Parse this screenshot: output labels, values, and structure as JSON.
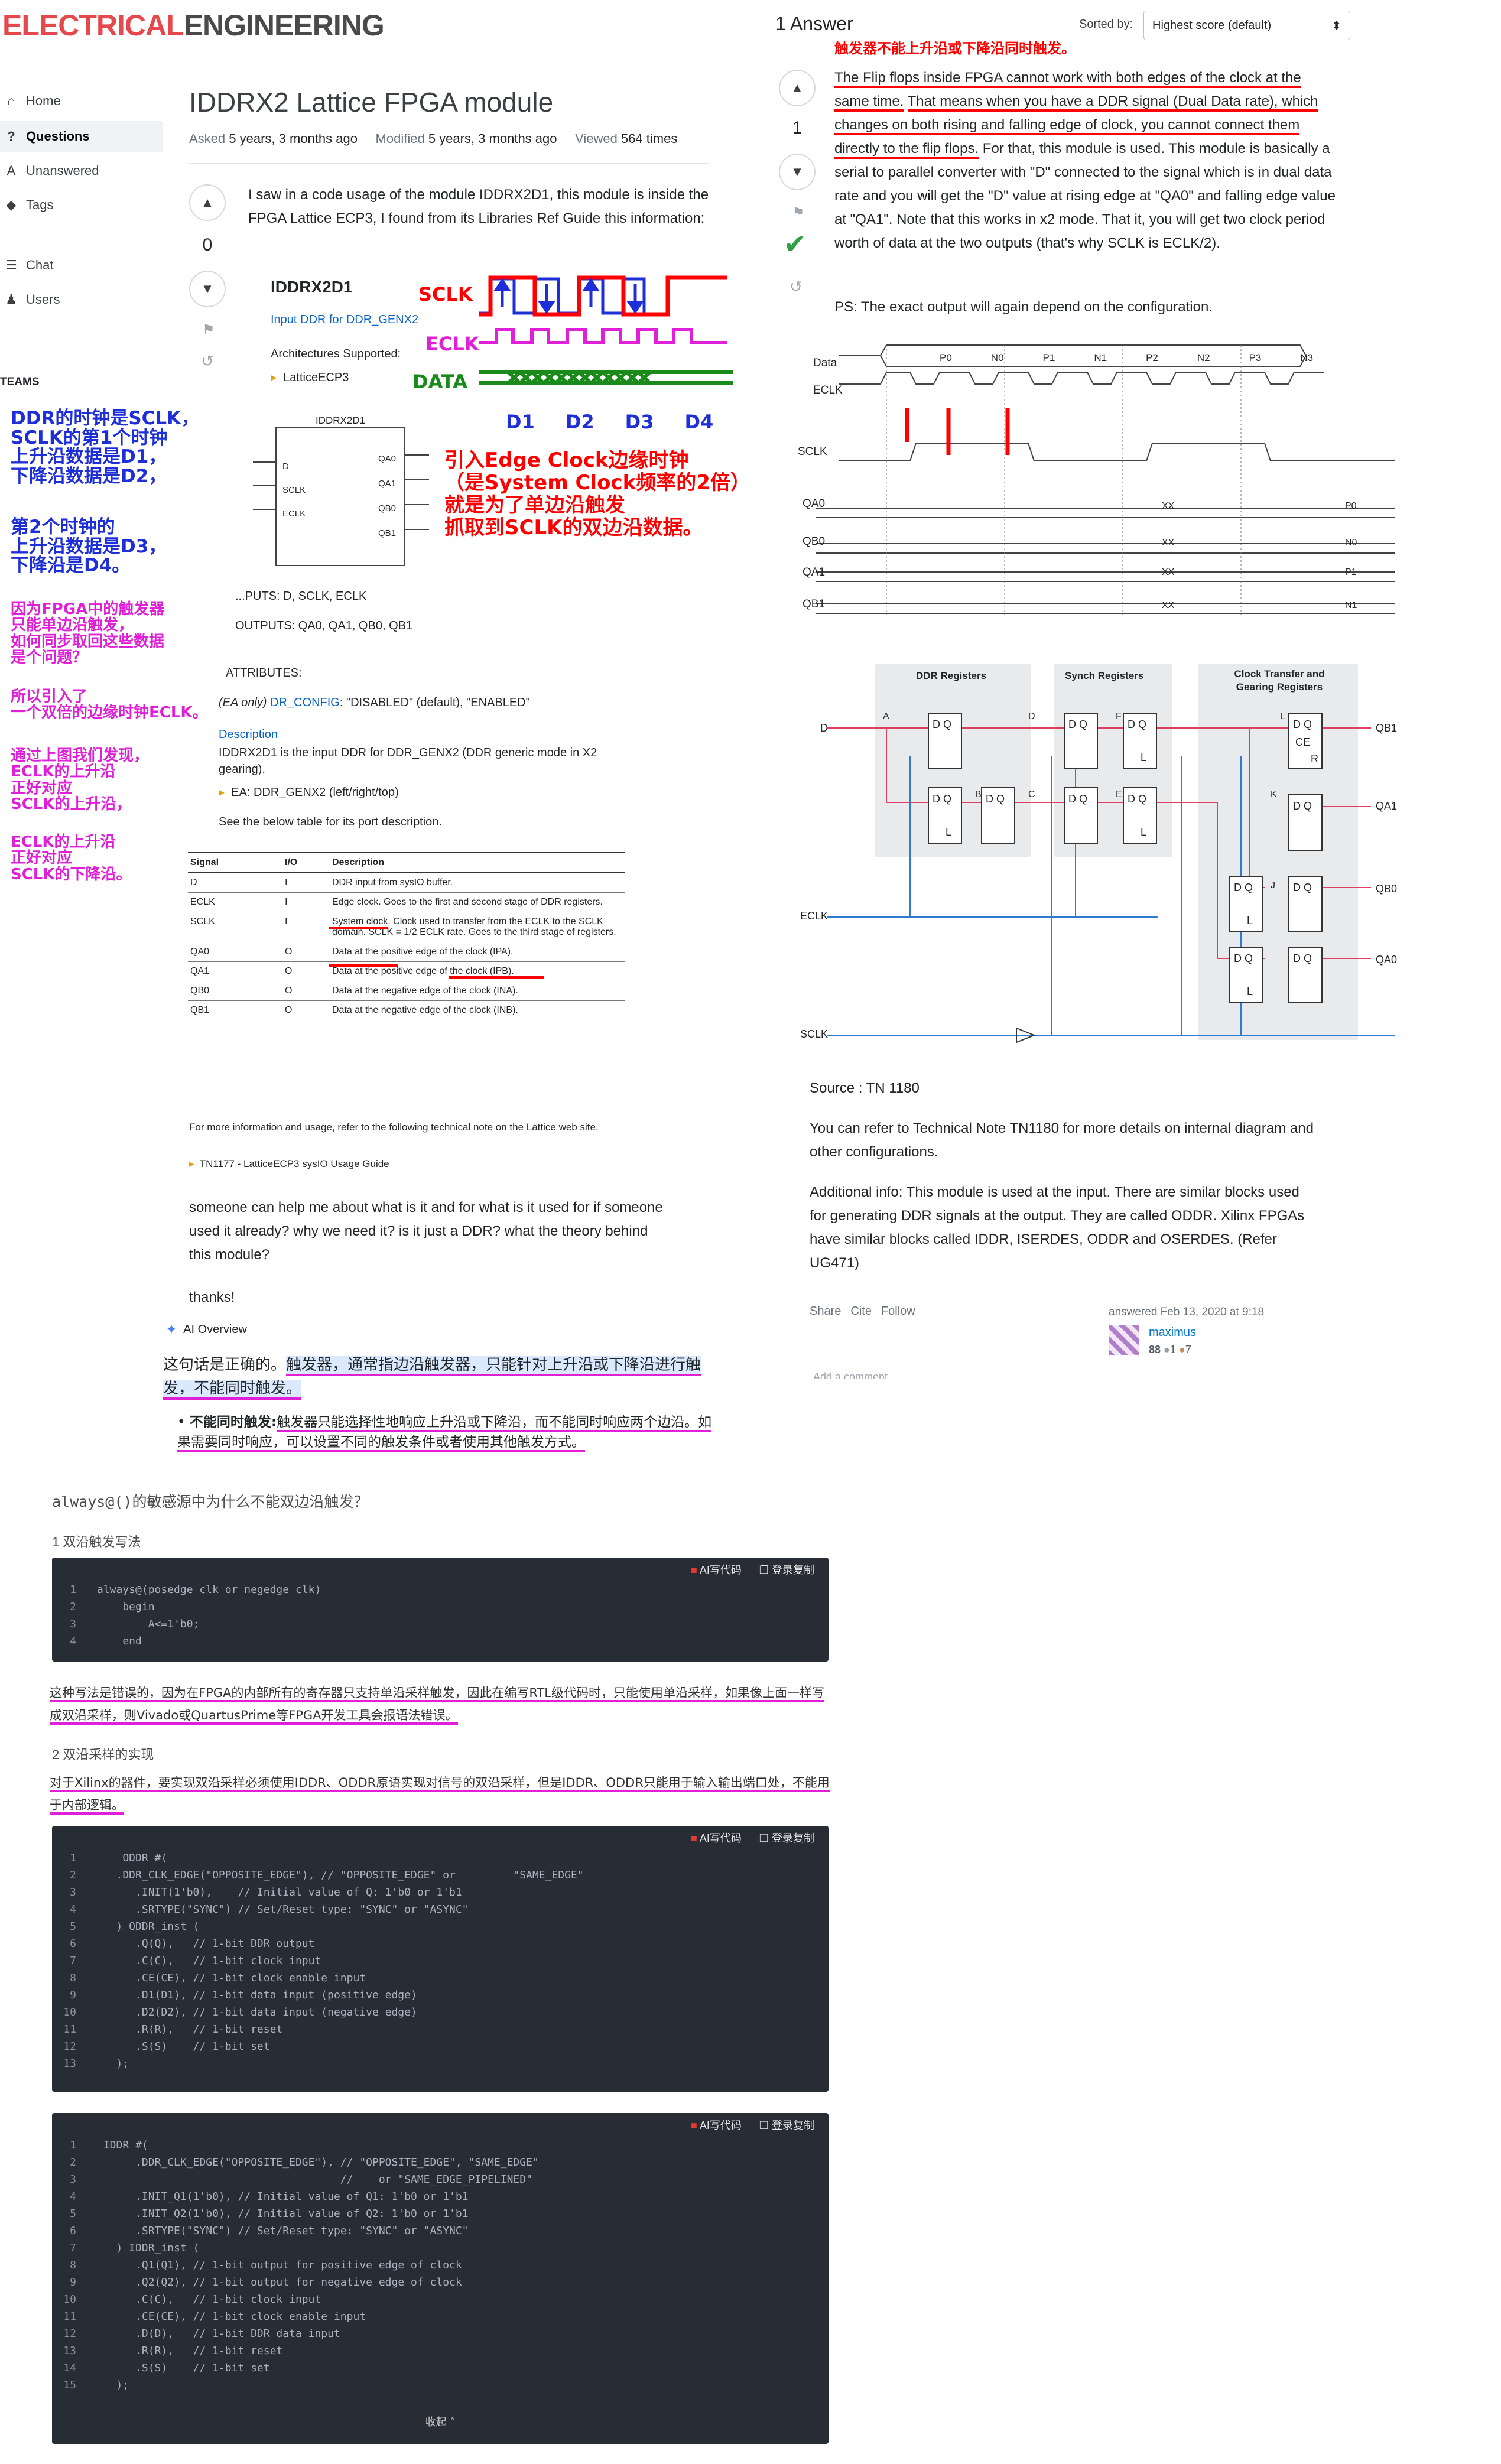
{
  "site": {
    "logo_part1": "ELECTRICAL",
    "logo_part2": "ENGINEERING"
  },
  "sidebar": {
    "items": [
      {
        "label": "Home",
        "icon": "home-icon"
      },
      {
        "label": "Questions",
        "icon": "questions-icon"
      },
      {
        "label": "Unanswered",
        "icon": "unanswered-icon"
      },
      {
        "label": "Tags",
        "icon": "tag-icon"
      },
      {
        "label": "Chat",
        "icon": "chat-icon"
      },
      {
        "label": "Users",
        "icon": "users-icon"
      }
    ],
    "teams": "TEAMS"
  },
  "annotations_left": {
    "a1": "DDR的时钟是SCLK，\nSCLK的第1个时钟\n上升沿数据是D1，\n下降沿数据是D2，",
    "a2": "第2个时钟的\n上升沿数据是D3，\n下降沿是D4。",
    "a3": "因为FPGA中的触发器\n只能单边沿触发，\n如何同步取回这些数据\n是个问题？",
    "a4": "所以引入了\n一个双倍的边缘时钟ECLK。",
    "a5": "通过上图我们发现，\nECLK的上升沿\n正好对应\nSCLK的上升沿，",
    "a6": "ECLK的上升沿\n正好对应\nSCLK的下降沿。"
  },
  "question": {
    "title": "IDDRX2 Lattice FPGA module",
    "asked_label": "Asked",
    "asked_value": "5 years, 3 months ago",
    "modified_label": "Modified",
    "modified_value": "5 years, 3 months ago",
    "viewed_label": "Viewed",
    "viewed_value": "564 times",
    "votes": "0",
    "intro": "I saw in a code usage of the module IDDRX2D1, this module is inside the FPGA Lattice ECP3, I found from its Libraries Ref Guide this information:",
    "doc": {
      "heading": "IDDRX2D1",
      "subtitle": "Input DDR for DDR_GENX2",
      "arch_label": "Architectures Supported:",
      "arch_value": "LatticeECP3",
      "block_name": "IDDRX2D1",
      "pins_left": [
        "D",
        "SCLK",
        "ECLK"
      ],
      "pins_right": [
        "QA0",
        "QA1",
        "QB0",
        "QB1"
      ],
      "inputs": "...PUTS: D, SCLK, ECLK",
      "outputs": "OUTPUTS: QA0, QA1, QB0, QB1",
      "attributes": "ATTRIBUTES:",
      "dr_config_prefix": "(EA only)",
      "dr_config_link": "DR_CONFIG",
      "dr_config_rest": ": \"DISABLED\" (default), \"ENABLED\"",
      "desc_heading": "Description",
      "desc_text": "IDDRX2D1 is the input DDR for DDR_GENX2 (DDR generic mode in X2 gearing).",
      "ea_line": "EA: DDR_GENX2 (left/right/top)",
      "table_intro": "See the below table for its port description.",
      "table_headers": [
        "Signal",
        "I/O",
        "Description"
      ],
      "table_rows": [
        [
          "D",
          "I",
          "DDR input from sysIO buffer."
        ],
        [
          "ECLK",
          "I",
          "Edge clock. Goes to the first and second stage of DDR registers."
        ],
        [
          "SCLK",
          "I",
          "System clock. Clock used to transfer from the ECLK to the SCLK domain. SCLK = 1/2 ECLK rate. Goes to the third stage of registers."
        ],
        [
          "QA0",
          "O",
          "Data at the positive edge of the clock (IPA)."
        ],
        [
          "QA1",
          "O",
          "Data at the positive edge of the clock (IPB)."
        ],
        [
          "QB0",
          "O",
          "Data at the negative edge of the clock (INA)."
        ],
        [
          "QB1",
          "O",
          "Data at the negative edge of the clock (INB)."
        ]
      ],
      "more_info": "For more information and usage, refer to the following technical note on the Lattice web site.",
      "tn_link": "TN1177 - LatticeECP3 sysIO Usage Guide"
    },
    "waveform": {
      "sclk": "SCLK",
      "eclk": "ECLK",
      "data": "DATA",
      "d_labels": [
        "D1",
        "D2",
        "D3",
        "D4"
      ]
    },
    "callout": "引入Edge Clock边缘时钟\n（是System Clock频率的2倍）\n就是为了单边沿触发\n抓取到SCLK的双边沿数据。",
    "ask": "someone can help me about what is it and for what is it used for if someone used it already? why we need it? is it just a DDR? what the theory behind this module?",
    "thanks": "thanks!"
  },
  "ai_overview": {
    "label": "AI Overview",
    "p1_plain": "这句话是正确的。",
    "p1_hl": "触发器，通常指边沿触发器，只能针对上升沿或下降沿进行触发，不能同时触发。",
    "bullet_bold": "不能同时触发:",
    "bullet_text": "触发器只能选择性地响应上升沿或下降沿，而不能同时响应两个边沿。如果需要同时响应，可以设置不同的触发条件或者使用其他触发方式。"
  },
  "answer": {
    "count": "1 Answer",
    "sorted_label": "Sorted by:",
    "sorted_value": "Highest score (default)",
    "top_note": "触发器不能上升沿或下降沿同时触发。",
    "votes": "1",
    "p1_red1": "The Flip flops inside FPGA cannot work with both edges of the clock at the same time.",
    "p1_mid": " ",
    "p1_red2": "That means when you have a DDR signal (Dual Data rate), which changes on both rising and falling edge of clock, you cannot connect them directly to the flip flops.",
    "p1_rest": " For that, this module is used. This module is basically a serial to parallel converter with \"D\" connected to the signal which is in dual data rate and you will get the \"D\" value at rising edge at \"QA0\" and falling edge value at \"QA1\". Note that this works in x2 mode. That it, you will get two clock period worth of data at the two outputs (that's why SCLK is ECLK/2).",
    "ps": "PS: The exact output will again depend on the configuration.",
    "timing": {
      "rows": [
        "Data",
        "ECLK",
        "SCLK",
        "QA0",
        "QB0",
        "QA1",
        "QB1"
      ],
      "data_labels": [
        "P0",
        "N0",
        "P1",
        "N1",
        "P2",
        "N2",
        "P3",
        "N3"
      ],
      "xx": "XX",
      "outs": [
        "P0",
        "N0",
        "P1",
        "N1"
      ]
    },
    "diagram": {
      "blocks": [
        "DDR Registers",
        "Synch Registers",
        "Clock Transfer and Gearing Registers"
      ],
      "inputs": [
        "D",
        "ECLK",
        "SCLK"
      ],
      "outputs": [
        "QB1",
        "QA1",
        "QB0",
        "QA0"
      ],
      "nodes": [
        "A",
        "B",
        "C",
        "D",
        "E",
        "F",
        "J",
        "K",
        "L"
      ],
      "dq": "D Q",
      "ce": "CE",
      "r": "R",
      "l": "L"
    },
    "source": "Source : TN 1180",
    "p2": "You can refer to Technical Note TN1180 for more details on internal diagram and other configurations.",
    "p3": "Additional info: This module is used at the input. There are similar blocks used for generating DDR signals at the output. They are called ODDR. Xilinx FPGAs have similar blocks called IDDR, ISERDES, ODDR and OSERDES. (Refer UG471)",
    "actions": [
      "Share",
      "Cite",
      "Follow"
    ],
    "answered": "answered Feb 13, 2020 at 9:18",
    "user": "maximus",
    "rep": "88",
    "badge_silver": "1",
    "badge_bronze": "7",
    "add_comment": "Add a comment"
  },
  "blog": {
    "question": "always@()的敏感源中为什么不能双边沿触发？",
    "h1": "1  双沿触发写法",
    "ai_code": "AI写代码",
    "login_copy": "登录复制",
    "code1": [
      "always@(posedge clk or negedge clk)",
      "    begin",
      "        A<=1'b0;",
      "    end"
    ],
    "p1": "这种写法是错误的，因为在FPGA的内部所有的寄存器只支持单沿采样触发，因此在编写RTL级代码时，只能使用单沿采样，如果像上面一样写成双沿采样，则Vivado或QuartusPrime等FPGA开发工具会报语法错误。",
    "h2": "2  双沿采样的实现",
    "p2": "对于Xilinx的器件，要实现双沿采样必须使用IDDR、ODDR原语实现对信号的双沿采样，但是IDDR、ODDR只能用于输入输出端口处，不能用于内部逻辑。",
    "code2": [
      "    ODDR #(",
      "   .DDR_CLK_EDGE(\"OPPOSITE_EDGE\"), // \"OPPOSITE_EDGE\" or         \"SAME_EDGE\"",
      "      .INIT(1'b0),    // Initial value of Q: 1'b0 or 1'b1",
      "      .SRTYPE(\"SYNC\") // Set/Reset type: \"SYNC\" or \"ASYNC\"",
      "   ) ODDR_inst (",
      "      .Q(Q),   // 1-bit DDR output",
      "      .C(C),   // 1-bit clock input",
      "      .CE(CE), // 1-bit clock enable input",
      "      .D1(D1), // 1-bit data input (positive edge)",
      "      .D2(D2), // 1-bit data input (negative edge)",
      "      .R(R),   // 1-bit reset",
      "      .S(S)    // 1-bit set",
      "   );"
    ],
    "code3": [
      " IDDR #(",
      "      .DDR_CLK_EDGE(\"OPPOSITE_EDGE\"), // \"OPPOSITE_EDGE\", \"SAME_EDGE\"",
      "                                      //    or \"SAME_EDGE_PIPELINED\"",
      "      .INIT_Q1(1'b0), // Initial value of Q1: 1'b0 or 1'b1",
      "      .INIT_Q2(1'b0), // Initial value of Q2: 1'b0 or 1'b1",
      "      .SRTYPE(\"SYNC\") // Set/Reset type: \"SYNC\" or \"ASYNC\"",
      "   ) IDDR_inst (",
      "      .Q1(Q1), // 1-bit output for positive edge of clock",
      "      .Q2(Q2), // 1-bit output for negative edge of clock",
      "      .C(C),   // 1-bit clock input",
      "      .CE(CE), // 1-bit clock enable input",
      "      .D(D),   // 1-bit DDR data input",
      "      .R(R),   // 1-bit reset",
      "      .S(S)    // 1-bit set",
      "   );"
    ],
    "collapse": "收起"
  }
}
